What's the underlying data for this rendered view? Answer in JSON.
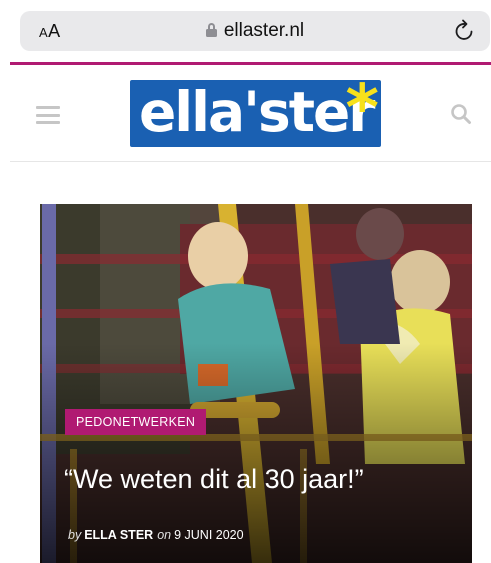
{
  "browser": {
    "text_size_label_small": "A",
    "text_size_label_large": "A",
    "url": "ellaster.nl",
    "icons": [
      "lock-icon",
      "reload-icon"
    ]
  },
  "site": {
    "logo_text": "ella'ster",
    "logo_star": "*",
    "brand_color": "#1a60b2",
    "accent_color": "#b01a72",
    "star_color": "#f7e11b",
    "icons": [
      "hamburger-menu-icon",
      "search-icon"
    ]
  },
  "article": {
    "category": "PEDONETWERKEN",
    "title": "“We weten dit al 30 jaar!”",
    "by_label": "by",
    "author": "ELLA STER",
    "on_label": "on",
    "date": "9 JUNI 2020"
  }
}
